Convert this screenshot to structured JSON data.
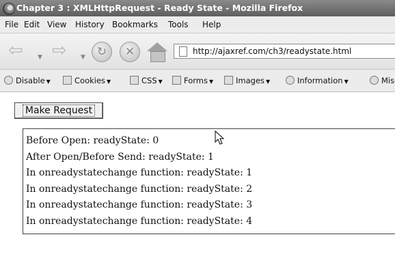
{
  "window": {
    "title": "Chapter 3 : XMLHttpRequest - Ready State - Mozilla Firefox"
  },
  "menu": {
    "items": [
      "File",
      "Edit",
      "View",
      "History",
      "Bookmarks",
      "Tools",
      "Help"
    ]
  },
  "navigation": {
    "url": "http://ajaxref.com/ch3/readystate.html",
    "icons": [
      "back-icon",
      "forward-icon",
      "reload-icon",
      "stop-icon",
      "home-icon",
      "page-icon"
    ]
  },
  "dev_toolbar": {
    "items": [
      {
        "label": "Disable",
        "icon": "disable-icon"
      },
      {
        "label": "Cookies",
        "icon": "cookies-icon"
      },
      {
        "label": "CSS",
        "icon": "css-icon"
      },
      {
        "label": "Forms",
        "icon": "forms-icon"
      },
      {
        "label": "Images",
        "icon": "images-icon"
      },
      {
        "label": "Information",
        "icon": "information-icon"
      },
      {
        "label": "Misc",
        "icon": "misc-icon"
      }
    ]
  },
  "content": {
    "button_label": "Make Request",
    "output_lines": [
      "Before Open: readyState: 0",
      "After Open/Before Send: readyState: 1",
      "In onreadystatechange function: readyState: 1",
      "In onreadystatechange function: readyState: 2",
      "In onreadystatechange function: readyState: 3",
      "In onreadystatechange function: readyState: 4"
    ]
  }
}
